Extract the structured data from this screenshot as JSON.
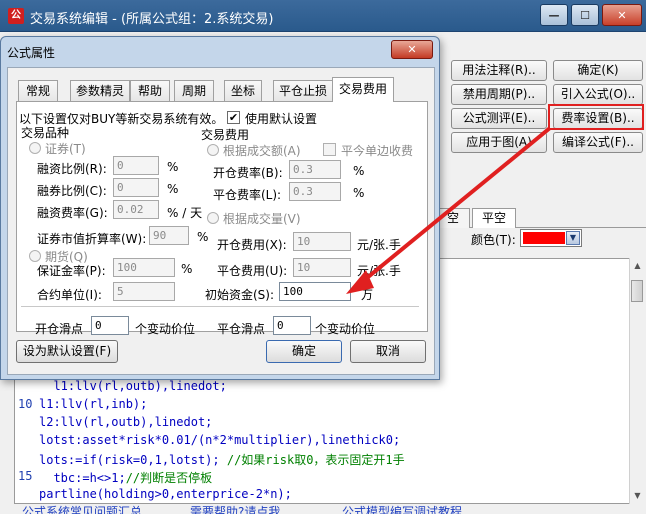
{
  "main_window": {
    "title": "交易系统编辑 - (所属公式组：2.系统交易)",
    "icon_text": "公",
    "buttons": {
      "syntax": "用法注释(R)..",
      "confirm": "确定(K)",
      "disable_period": "禁用周期(P)..",
      "import_formula": "引入公式(O)..",
      "formula_test": "公式测评(E)..",
      "fee_settings": "费率设置(B)..",
      "apply_chart": "应用于图(A)",
      "compile": "编译公式(F).."
    },
    "tabs": [
      "空",
      "平空"
    ],
    "color_label": "颜色(T):",
    "color_value": "#ff0000",
    "editor": {
      "line_numbers": [
        "10",
        "15"
      ],
      "lines": [
        "  l1:llv(rl,outb),linedot;",
        "l1:llv(rl,inb);",
        "l2:llv(rl,outb),linedot;",
        "lotst:asset*risk*0.01/(n*2*multiplier),linethick0;",
        "lots:=if(risk=0,1,lotst); ",
        "  tbc:=h<>1;",
        "partline(holding>0,enterprice-2*n);"
      ],
      "comments": [
        "//如果risk取0，表示固定开1手",
        "//判断是否停板"
      ]
    },
    "footer_links": [
      "公式系统常见问题汇总",
      "需要帮助?请点我",
      "公式模型编写调试教程"
    ]
  },
  "dialog": {
    "title": "公式属性",
    "tabs": [
      "常规",
      "参数精灵",
      "帮助",
      "周期",
      "坐标",
      "平仓止损",
      "交易费用"
    ],
    "active_tab": "交易费用",
    "intro": "以下设置仅对BUY等新交易系统有效。",
    "use_default_label": "使用默认设置",
    "use_default_checked": "✔",
    "trade_type_label": "交易品种",
    "stock_label": "证券(T)",
    "financing_ratio_label": "融资比例(R):",
    "financing_ratio_value": "0",
    "short_ratio_label": "融券比例(C):",
    "short_ratio_value": "0",
    "financing_rate_label": "融资费率(G):",
    "financing_rate_value": "0.02",
    "financing_rate_unit": "% / 天",
    "percent": "%",
    "fee_label": "交易费用",
    "by_amount_label": "根据成交额(A)",
    "open_close_single": "平今单边收费",
    "open_rate_label": "开仓费率(B):",
    "open_rate_value": "0.3",
    "close_rate_label": "平仓费率(L):",
    "close_rate_value": "0.3",
    "by_volume_label": "根据成交量(V)",
    "stock_value_ratio_label": "证券市值折算率(W):",
    "stock_value_ratio_value": "90",
    "futures_label": "期货(Q)",
    "open_fee_label": "开仓费用(X):",
    "open_fee_value": "10",
    "close_fee_label": "平仓费用(U):",
    "close_fee_value": "10",
    "fee_unit": "元/张.手",
    "margin_label": "保证金率(P):",
    "margin_value": "100",
    "contract_unit_label": "合约单位(I):",
    "contract_unit_value": "5",
    "initial_capital_label": "初始资金(S):",
    "initial_capital_value": "100",
    "initial_capital_unit": "万",
    "open_slippage_label": "开仓滑点",
    "open_slippage_value": "0",
    "close_slippage_label": "平仓滑点",
    "close_slippage_value": "0",
    "slippage_unit": "个变动价位",
    "set_default_button": "设为默认设置(F)",
    "ok_button": "确定",
    "cancel_button": "取消"
  }
}
